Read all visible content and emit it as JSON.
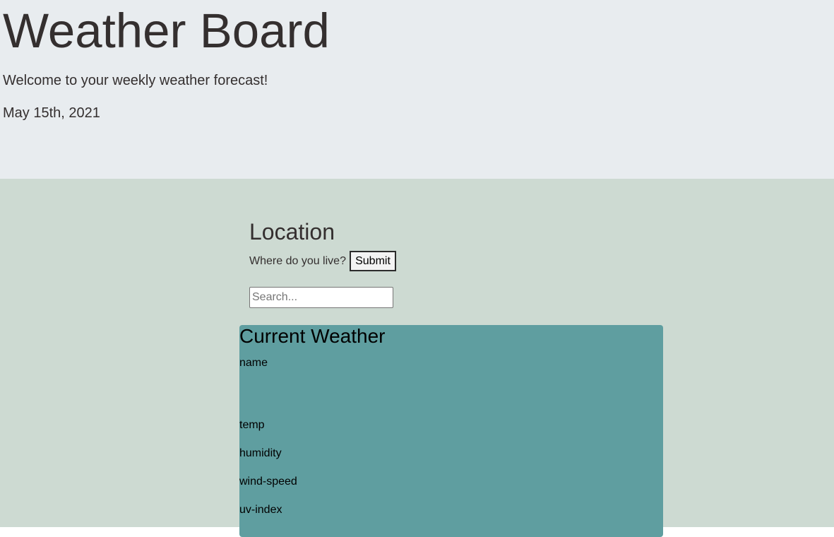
{
  "header": {
    "title": "Weather Board",
    "welcome": "Welcome to your weekly weather forecast!",
    "date": "May 15th, 2021"
  },
  "location": {
    "title": "Location",
    "question": "Where do you live?",
    "submit_label": "Submit",
    "search_placeholder": "Search..."
  },
  "current_weather": {
    "title": "Current Weather",
    "fields": {
      "name": "name",
      "temp": "temp",
      "humidity": "humidity",
      "wind_speed": "wind-speed",
      "uv_index": "uv-index"
    }
  },
  "colors": {
    "header_bg": "#e8ecef",
    "main_bg": "#cddad2",
    "card_bg": "#5f9ea0",
    "text": "#342f2f"
  }
}
